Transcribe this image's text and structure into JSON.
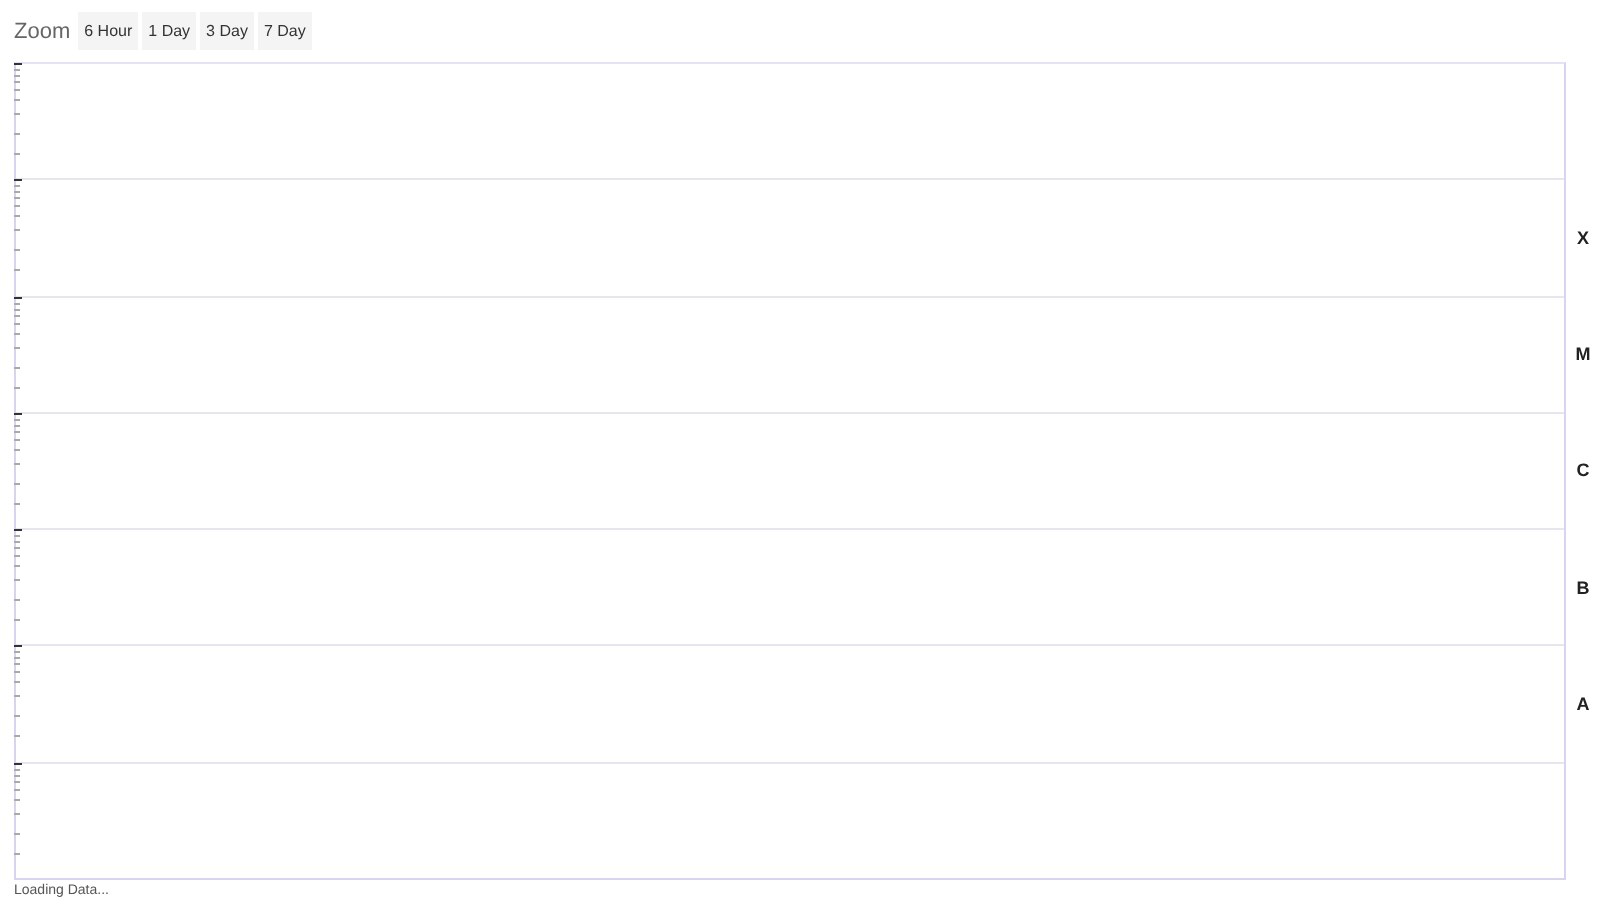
{
  "zoom": {
    "label": "Zoom",
    "buttons": [
      "6 Hour",
      "1 Day",
      "3 Day",
      "7 Day"
    ]
  },
  "flux_classes": [
    "X",
    "M",
    "C",
    "B",
    "A"
  ],
  "status": "Loading Data..."
}
